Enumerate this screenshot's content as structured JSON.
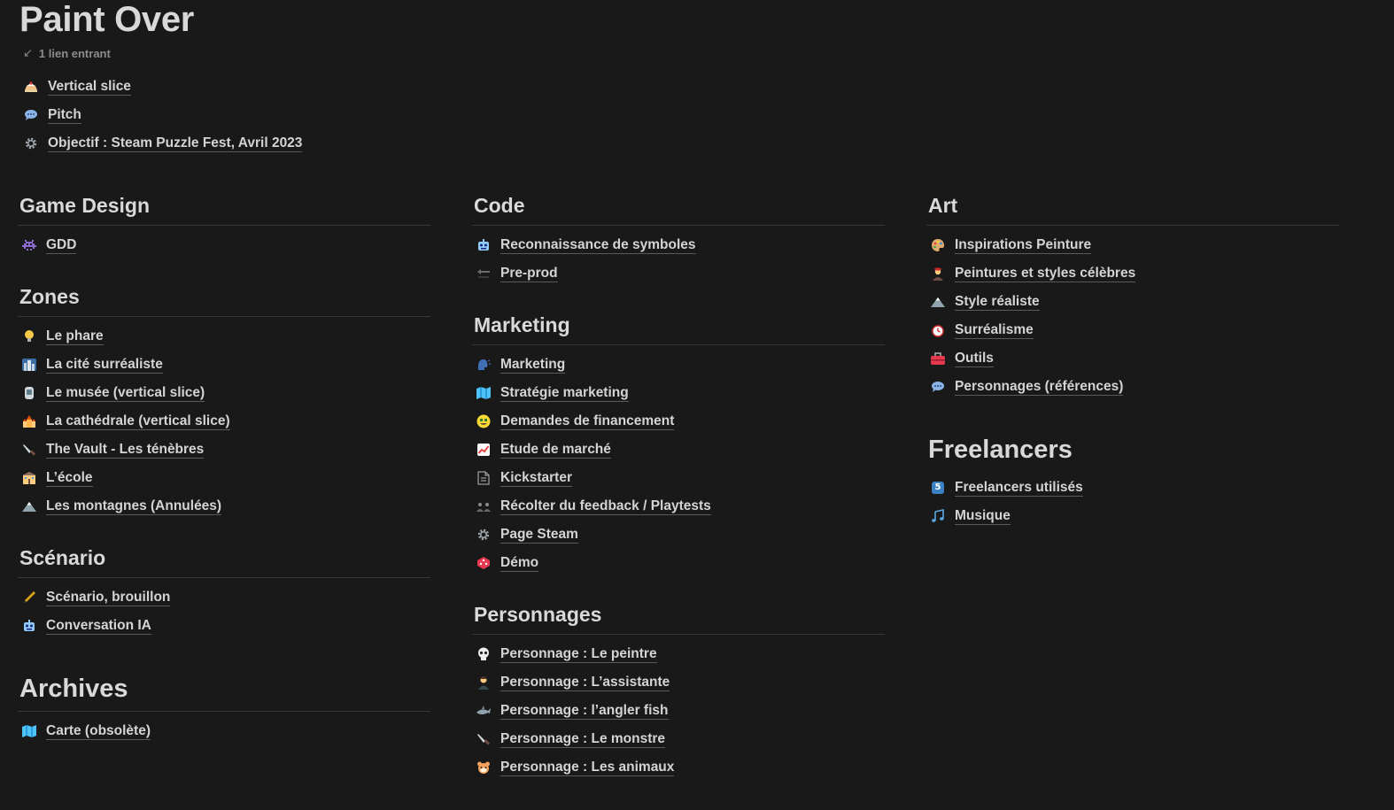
{
  "page": {
    "title": "Paint Over",
    "backlinks_arrow": "↙",
    "backlinks": "1 lien entrant"
  },
  "top_links": [
    {
      "label": "Vertical slice",
      "icon": "cake-icon"
    },
    {
      "label": "Pitch",
      "icon": "speech-bubble-icon"
    },
    {
      "label": "Objectif : Steam Puzzle Fest, Avril 2023",
      "icon": "gear-icon"
    }
  ],
  "sections": {
    "game_design": {
      "title": "Game Design",
      "items": [
        {
          "label": "GDD",
          "icon": "space-invader-icon"
        }
      ]
    },
    "zones": {
      "title": "Zones",
      "items": [
        {
          "label": "Le phare",
          "icon": "lightbulb-icon"
        },
        {
          "label": "La cité surréaliste",
          "icon": "city-icon"
        },
        {
          "label": "Le musée (vertical slice)",
          "icon": "museum-icon"
        },
        {
          "label": "La cathédrale (vertical slice)",
          "icon": "cathedral-icon"
        },
        {
          "label": "The Vault - Les ténèbres",
          "icon": "knife-icon"
        },
        {
          "label": "L’école",
          "icon": "school-icon"
        },
        {
          "label": "Les montagnes (Annulées)",
          "icon": "mountain-icon"
        }
      ]
    },
    "scenario": {
      "title": "Scénario",
      "items": [
        {
          "label": "Scénario, brouillon",
          "icon": "pen-icon"
        },
        {
          "label": "Conversation IA",
          "icon": "robot-icon"
        }
      ]
    },
    "archives": {
      "title": "Archives",
      "items": [
        {
          "label": "Carte (obsolète)",
          "icon": "map-icon"
        }
      ]
    },
    "code": {
      "title": "Code",
      "items": [
        {
          "label": "Reconnaissance de symboles",
          "icon": "robot-icon"
        },
        {
          "label": "Pre-prod",
          "icon": "back-arrow-icon"
        }
      ]
    },
    "marketing": {
      "title": "Marketing",
      "items": [
        {
          "label": "Marketing",
          "icon": "speaking-head-icon"
        },
        {
          "label": "Stratégie marketing",
          "icon": "map-icon"
        },
        {
          "label": "Demandes de financement",
          "icon": "money-face-icon"
        },
        {
          "label": "Etude de marché",
          "icon": "chart-up-icon"
        },
        {
          "label": "Kickstarter",
          "icon": "document-icon"
        },
        {
          "label": "Récolter du feedback / Playtests",
          "icon": "people-icon"
        },
        {
          "label": "Page Steam",
          "icon": "gear-icon"
        },
        {
          "label": "Démo",
          "icon": "die-icon"
        }
      ]
    },
    "personnages": {
      "title": "Personnages",
      "items": [
        {
          "label": "Personnage : Le peintre",
          "icon": "skull-icon"
        },
        {
          "label": "Personnage : L’assistante",
          "icon": "person-icon"
        },
        {
          "label": "Personnage : l’angler fish",
          "icon": "shark-icon"
        },
        {
          "label": "Personnage : Le monstre",
          "icon": "knife-icon"
        },
        {
          "label": "Personnage : Les animaux",
          "icon": "hamster-icon"
        }
      ]
    },
    "art": {
      "title": "Art",
      "items": [
        {
          "label": "Inspirations Peinture",
          "icon": "palette-icon"
        },
        {
          "label": "Peintures et styles célèbres",
          "icon": "artist-icon"
        },
        {
          "label": "Style réaliste",
          "icon": "mountain-icon"
        },
        {
          "label": "Surréalisme",
          "icon": "clock-icon"
        },
        {
          "label": "Outils",
          "icon": "toolbox-icon"
        },
        {
          "label": "Personnages (références)",
          "icon": "speech-bubble-icon"
        }
      ]
    },
    "freelancers": {
      "title": "Freelancers",
      "items": [
        {
          "label": "Freelancers utilisés",
          "icon": "number-five-icon",
          "icon_text": "5"
        },
        {
          "label": "Musique",
          "icon": "music-notes-icon"
        }
      ]
    }
  },
  "colors": {
    "background": "#191919",
    "text": "#d4d4d4",
    "muted": "#8c8c8c",
    "divider": "#373737"
  }
}
